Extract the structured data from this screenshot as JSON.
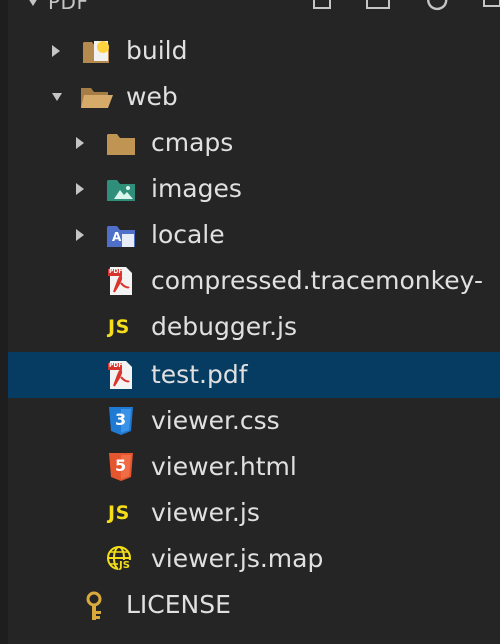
{
  "explorer": {
    "section_title": "PDF",
    "items": [
      {
        "label": "build",
        "type": "folder",
        "icon": "build-folder-icon"
      },
      {
        "label": "web",
        "type": "folder",
        "icon": "folder-open-icon"
      },
      {
        "label": "cmaps",
        "type": "folder",
        "icon": "folder-icon"
      },
      {
        "label": "images",
        "type": "folder",
        "icon": "images-folder-icon"
      },
      {
        "label": "locale",
        "type": "folder",
        "icon": "locale-folder-icon"
      },
      {
        "label": "compressed.tracemonkey-",
        "type": "file",
        "icon": "pdf-file-icon"
      },
      {
        "label": "debugger.js",
        "type": "file",
        "icon": "js-file-icon"
      },
      {
        "label": "test.pdf",
        "type": "file",
        "icon": "pdf-file-icon",
        "selected": true
      },
      {
        "label": "viewer.css",
        "type": "file",
        "icon": "css-file-icon"
      },
      {
        "label": "viewer.html",
        "type": "file",
        "icon": "html-file-icon"
      },
      {
        "label": "viewer.js",
        "type": "file",
        "icon": "js-file-icon"
      },
      {
        "label": "viewer.js.map",
        "type": "file",
        "icon": "map-file-icon"
      },
      {
        "label": "LICENSE",
        "type": "file",
        "icon": "license-file-icon"
      }
    ],
    "icons_text": {
      "js": "JS",
      "pdf_tag": "PDF",
      "css_number": "3",
      "html_number": "5",
      "locale_letter": "A"
    }
  },
  "colors": {
    "background": "#252526",
    "selection": "#063b62",
    "text": "#e0e0e0",
    "folder": "#c09553",
    "images_folder": "#3da68a",
    "locale_folder": "#5c7bd6",
    "js": "#f5de19",
    "css": "#1f7ad4",
    "html": "#e4572e",
    "pdf": "#d8342b"
  }
}
